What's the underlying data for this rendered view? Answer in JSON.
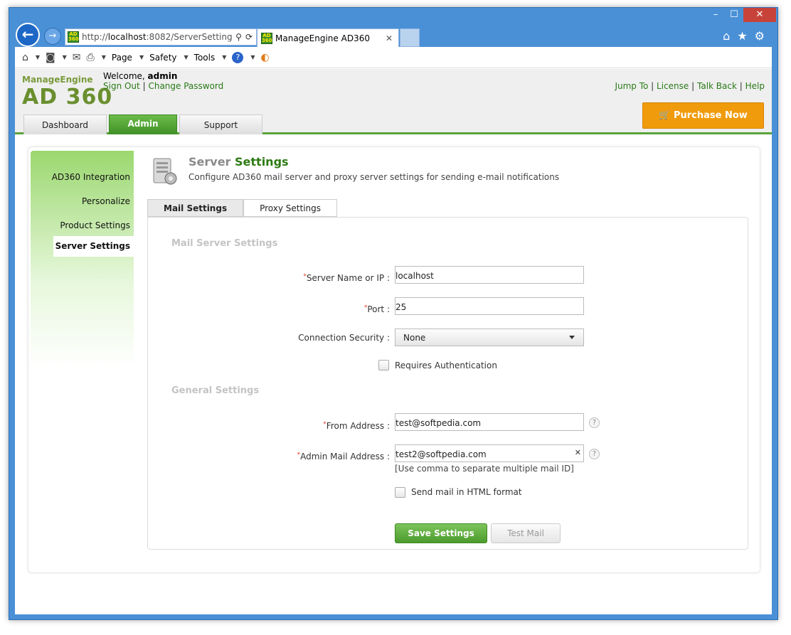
{
  "browser": {
    "window_controls": {
      "minimize": "–",
      "maximize": "☐",
      "close": "✕"
    },
    "back_glyph": "←",
    "forward_glyph": "→",
    "address": {
      "prefix": "http://",
      "host": "localhost",
      "rest": ":8082/ServerSettings",
      "search_glyph": "⚲",
      "refresh_glyph": "⟳"
    },
    "favicon_text": "AD 360",
    "tab": {
      "title": "ManageEngine AD360",
      "close": "✕"
    },
    "right_icons": {
      "home": "⌂",
      "favorites": "★",
      "settings": "⚙"
    }
  },
  "command_bar": {
    "items": [
      "Page",
      "Safety",
      "Tools"
    ],
    "help_glyph": "?"
  },
  "header": {
    "logo_top": "ManageEngine",
    "logo_main": "AD 360",
    "welcome_label": "Welcome,",
    "username": "admin",
    "sign_out": "Sign Out",
    "separator": "|",
    "change_password": "Change Password",
    "top_links": [
      "Jump To",
      "License",
      "Talk Back",
      "Help"
    ],
    "purchase_label": "Purchase Now",
    "cart_glyph": "🛒",
    "tabs": [
      "Dashboard",
      "Admin",
      "Support"
    ]
  },
  "sidebar": {
    "items": [
      "AD360 Integration",
      "Personalize",
      "Product Settings",
      "Server Settings"
    ]
  },
  "page": {
    "title_part1": "Server",
    "title_part2": "Settings",
    "description": "Configure AD360 mail server and proxy server settings for sending e-mail notifications",
    "subtabs": [
      "Mail Settings",
      "Proxy Settings"
    ]
  },
  "form": {
    "mail_section": "Mail Server Settings",
    "server_label": "Server Name or IP :",
    "server_value": "localhost",
    "port_label": "Port :",
    "port_value": "25",
    "security_label": "Connection Security :",
    "security_value": "None",
    "auth_label": "Requires Authentication",
    "general_section": "General Settings",
    "from_label": "From Address :",
    "from_value": "test@softpedia.com",
    "admin_label": "Admin Mail Address :",
    "admin_value": "test2@softpedia.com",
    "admin_hint": "[Use comma to separate multiple mail ID]",
    "html_label": "Send mail in HTML format",
    "required_mark": "*",
    "help_glyph": "?",
    "clear_glyph": "✕",
    "save_button": "Save Settings",
    "test_button": "Test Mail"
  }
}
